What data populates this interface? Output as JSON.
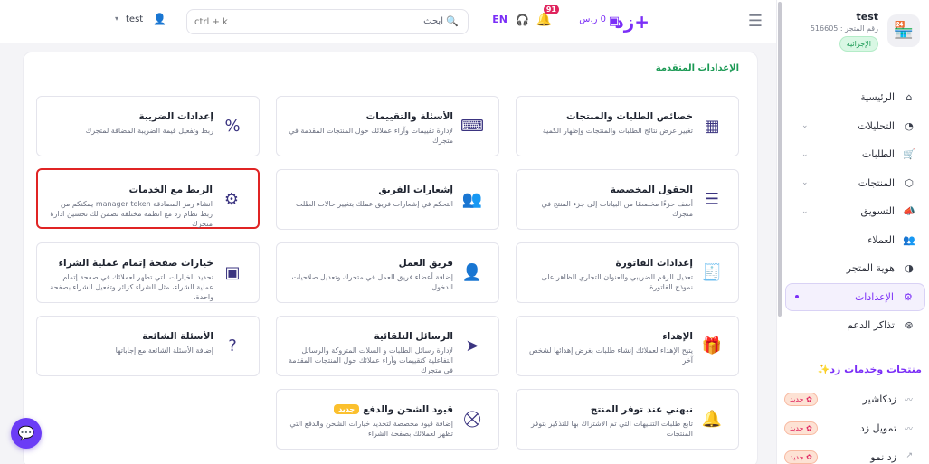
{
  "topbar": {
    "logo": "زد+",
    "balance": "0 ر.س",
    "notifications_count": "91",
    "language": "EN",
    "search_label": "ابحث",
    "search_placeholder": "ctrl + k",
    "user_name": "test"
  },
  "sidebar": {
    "store_name": "test",
    "store_id": "رقم المتجر : 516605",
    "store_button": "الإجرائية",
    "items": [
      {
        "label": "الرئيسية",
        "icon": "home-icon"
      },
      {
        "label": "التحليلات",
        "icon": "analytics-icon"
      },
      {
        "label": "الطلبات",
        "icon": "orders-icon"
      },
      {
        "label": "المنتجات",
        "icon": "products-icon"
      },
      {
        "label": "التسويق",
        "icon": "marketing-icon"
      },
      {
        "label": "العملاء",
        "icon": "customers-icon"
      },
      {
        "label": "هوية المتجر",
        "icon": "store-identity-icon"
      },
      {
        "label": "الإعدادات",
        "icon": "settings-icon"
      },
      {
        "label": "تذاكر الدعم",
        "icon": "support-icon"
      }
    ],
    "products_title": "منتجات وخدمات زد✨",
    "sub_items": [
      {
        "label": "زدكاشير",
        "badge": "جديد"
      },
      {
        "label": "تمويل زد",
        "badge": "جديد"
      },
      {
        "label": "زد نمو",
        "badge": "جديد"
      }
    ]
  },
  "panel": {
    "title": "الإعدادات المتقدمة",
    "cards": [
      {
        "title": "خصائص الطلبات والمنتجات",
        "desc": "تغيير عرض نتائج الطلبات والمنتجات وإظهار الكمية",
        "icon": "grid-icon"
      },
      {
        "title": "الأسئلة والتقييمات",
        "desc": "لإدارة تقييمات وآراء عملائك حول المنتجات المقدمة في متجرك",
        "icon": "reviews-icon"
      },
      {
        "title": "إعدادات الضريبة",
        "desc": "ربط وتفعيل قيمة الضريبة المضافة لمتجرك",
        "icon": "tax-icon"
      },
      {
        "title": "الحقول المخصصة",
        "desc": "أضف حزءًا مخصصًا من البيانات إلى جزء المنتج في متجرك",
        "icon": "custom-fields-icon"
      },
      {
        "title": "إشعارات الفريق",
        "desc": "التحكم في إشعارات فريق عملك بتغيير حالات الطلب",
        "icon": "team-notifications-icon"
      },
      {
        "title": "الربط مع الخدمات",
        "desc": "انشاء رمز المصادقة manager token يمكنكم من ربط نظام زد مع انظمة مختلفة تضمن لك تحسين ادارة متجرك",
        "icon": "services-icon"
      },
      {
        "title": "إعدادات الفاتورة",
        "desc": "تعديل الرقم الضريبي والعنوان التجاري الظاهر على نموذج الفاتورة",
        "icon": "invoice-icon"
      },
      {
        "title": "فريق العمل",
        "desc": "إضافة أعضاء فريق العمل في متجرك وتعديل صلاحيات الدخول",
        "icon": "team-icon"
      },
      {
        "title": "خيارات صفحة إتمام عملية الشراء",
        "desc": "تحديد الخيارات التي تظهر لعملائك في صفحة إتمام عملية الشراء، مثل الشراء كزائر وتفعيل الشراء بصفحة واحدة.",
        "icon": "checkout-icon"
      },
      {
        "title": "الإهداء",
        "desc": "يتيح الإهداء لعملائك إنشاء طلبات بغرض إهدائها لشخص آخر",
        "icon": "gift-icon"
      },
      {
        "title": "الرسائل التلقائية",
        "desc": "لإدارة رسائل الطلبات و السلات المتروكة والرسائل التفاعلية كتقييمات وآراء عملائك حول المنتجات المقدمة في متجرك",
        "icon": "send-icon"
      },
      {
        "title": "الأسئلة الشائعة",
        "desc": "إضافة الأسئلة الشائعة مع إجاباتها",
        "icon": "faq-icon"
      },
      {
        "title": "نبهني عند توفر المنتج",
        "desc": "تابع طلبات التنبيهات التي تم الاشتراك بها للتذكير بتوفر المنتجات",
        "icon": "alert-bell-icon"
      },
      {
        "title": "قيود الشحن والدفع",
        "tag": "جديد",
        "desc": "إضافة قيود مخصصة لتحديد خيارات الشحن والدفع التي تظهر لعملائك بصفحة الشراء",
        "icon": "shipping-restrictions-icon"
      }
    ]
  }
}
